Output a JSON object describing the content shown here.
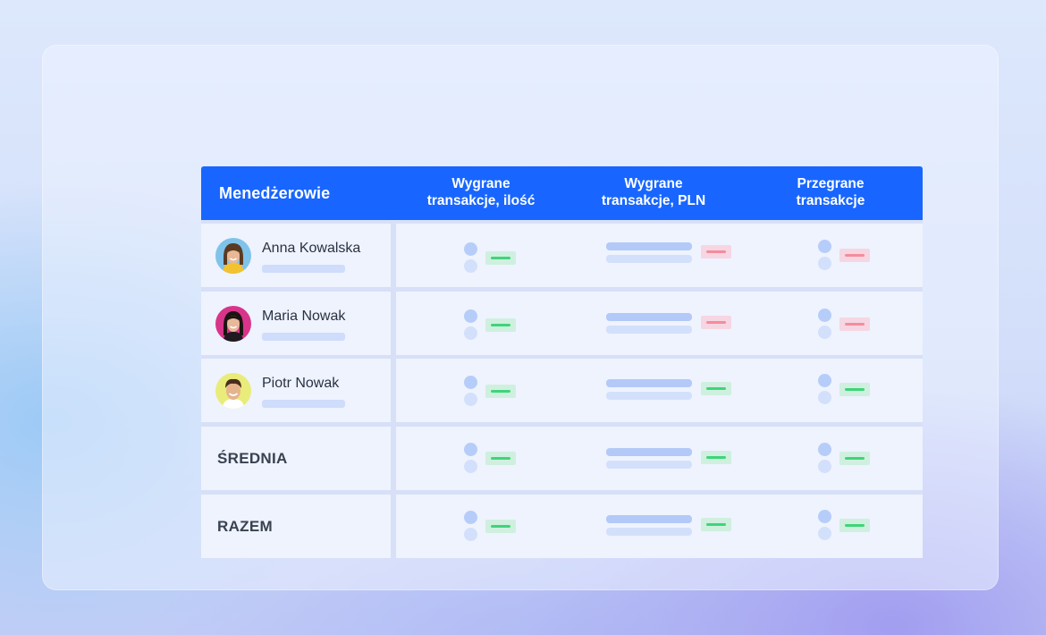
{
  "table": {
    "header": {
      "managers": "Menedżerowie",
      "columns": [
        {
          "line1": "Wygrane",
          "line2": "transakcje, ilość"
        },
        {
          "line1": "Wygrane",
          "line2": "transakcje, PLN"
        },
        {
          "line1": "Przegrane",
          "line2": "transakcje"
        }
      ]
    },
    "managers": [
      {
        "name": "Anna Kowalska",
        "won_count_status": "green",
        "won_pln_status": "red",
        "lost_status": "red"
      },
      {
        "name": "Maria Nowak",
        "won_count_status": "green",
        "won_pln_status": "red",
        "lost_status": "red"
      },
      {
        "name": "Piotr Nowak",
        "won_count_status": "green",
        "won_pln_status": "green",
        "lost_status": "green"
      }
    ],
    "summary": [
      {
        "label": "ŚREDNIA"
      },
      {
        "label": "RAZEM"
      }
    ]
  },
  "colors": {
    "header_blue": "#1866ff",
    "positive": "#3fd47a",
    "negative": "#f48c9c"
  }
}
